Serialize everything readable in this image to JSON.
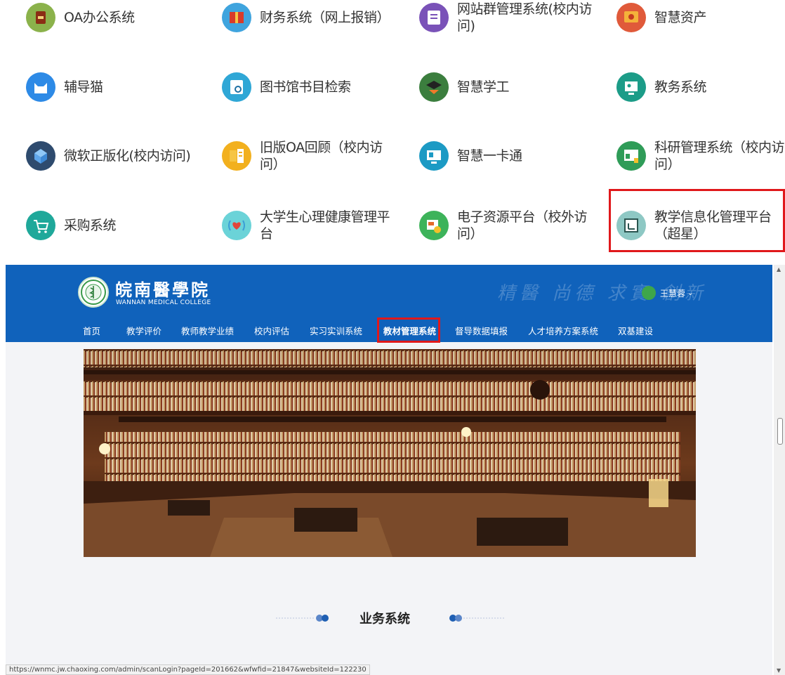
{
  "apps": [
    {
      "label": "OA办公系统",
      "icon": "oa-office-icon",
      "color": "#8bb24b"
    },
    {
      "label": "财务系统（网上报销）",
      "icon": "finance-icon",
      "color": "#3fa4de"
    },
    {
      "label": "网站群管理系统(校内访问)",
      "icon": "website-cluster-icon",
      "color": "#7a52b8"
    },
    {
      "label": "智慧资产",
      "icon": "smart-assets-icon",
      "color": "#e05a3a"
    },
    {
      "label": "辅导猫",
      "icon": "tutor-cat-icon",
      "color": "#2d8ae6"
    },
    {
      "label": "图书馆书目检索",
      "icon": "library-search-icon",
      "color": "#2fa7d6"
    },
    {
      "label": "智慧学工",
      "icon": "smart-student-affairs-icon",
      "color": "#3b7e3e"
    },
    {
      "label": "教务系统",
      "icon": "academic-affairs-icon",
      "color": "#1c9c88"
    },
    {
      "label": "微软正版化(校内访问)",
      "icon": "microsoft-license-icon",
      "color": "#2e4b6e"
    },
    {
      "label": "旧版OA回顾（校内访问）",
      "icon": "legacy-oa-icon",
      "color": "#f2b01e"
    },
    {
      "label": "智慧一卡通",
      "icon": "smart-card-icon",
      "color": "#1c9ac4"
    },
    {
      "label": "科研管理系统（校内访问）",
      "icon": "research-management-icon",
      "color": "#2f9c58"
    },
    {
      "label": "采购系统",
      "icon": "procurement-icon",
      "color": "#1fa89a"
    },
    {
      "label": "大学生心理健康管理平台",
      "icon": "mental-health-icon",
      "color": "#6bd3d8"
    },
    {
      "label": "电子资源平台（校外访问）",
      "icon": "e-resources-icon",
      "color": "#3db35a"
    },
    {
      "label": "教学信息化管理平台（超星）",
      "icon": "teaching-informatization-icon",
      "color": "#8ec8c4"
    }
  ],
  "site": {
    "logo_cn": "皖南醫學院",
    "logo_en": "WANNAN MEDICAL COLLEGE",
    "calligraphy": "精醫 尚德 求實 創新",
    "user_name": "王慧蓉",
    "nav": [
      "首页",
      "教学评价",
      "教师教学业绩",
      "校内评估",
      "实习实训系统",
      "教材管理系统",
      "督导数据填报",
      "人才培养方案系统",
      "双基建设"
    ],
    "active_nav": "教材管理系统",
    "section_title": "业务系统",
    "header_color": "#1062bb",
    "highlight_color": "#e0181b"
  },
  "status_url": "https://wnmc.jw.chaoxing.com/admin/scanLogin?pageId=201662&wfwfid=21847&websiteId=122230"
}
